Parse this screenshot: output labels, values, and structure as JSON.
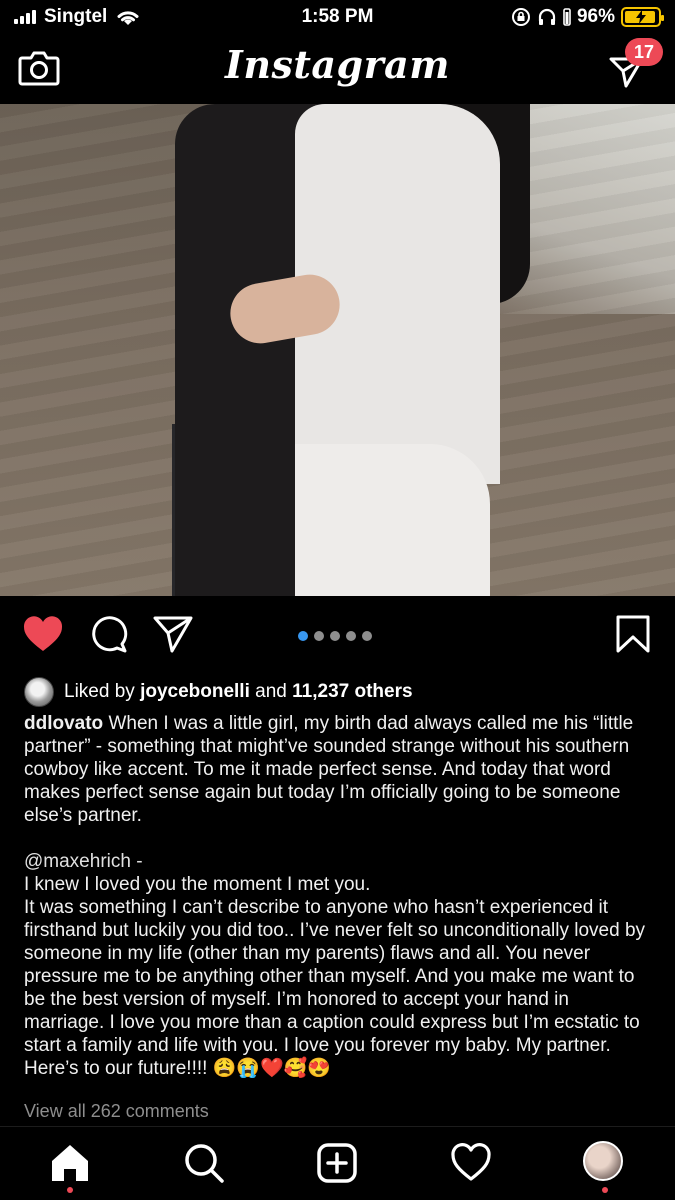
{
  "status_bar": {
    "carrier": "Singtel",
    "time": "1:58 PM",
    "battery": "96%"
  },
  "header": {
    "logo": "Instagram",
    "direct_badge": "17",
    "icons": [
      "camera-icon",
      "direct-message-icon"
    ]
  },
  "post": {
    "photo_icon": "beach-couple-photo",
    "carousel": {
      "count": 5,
      "active_index": 0
    },
    "likes": {
      "prefix": "Liked by",
      "user": "joycebonelli",
      "and": "and",
      "others": "11,237 others"
    },
    "caption": {
      "username": "ddlovato",
      "text": "When I was a little girl, my birth dad always called me his “little partner” - something that might’ve sounded strange without his southern cowboy like accent. To me it made perfect sense. And today that word makes perfect sense again but today I’m officially going to be someone else’s partner.",
      "mention": "@maxehrich -",
      "line1": "I knew I loved you the moment I met you.",
      "body": "It was something I can’t describe to anyone who hasn’t experienced it firsthand but luckily you did too.. I’ve never felt so unconditionally loved by someone in my life (other than my parents) flaws and all. You never pressure me to be anything other than myself. And you make me want to be the best version of myself. I’m honored to accept your hand in marriage. I love you more than a caption could express but I’m ecstatic to start a family and life with you. I love you forever my baby. My partner. Here’s to our future!!!! 😩😭❤️🥰😍"
    },
    "view_comments": "View all 262 comments"
  },
  "colors": {
    "like_red": "#ed4956",
    "badge_red": "#ed4956",
    "carousel_active": "#3897f0",
    "muted": "#8e8e8e",
    "battery_yellow": "#f5c400"
  },
  "bottom_nav": [
    "home-icon",
    "search-icon",
    "add-post-icon",
    "activity-heart-icon",
    "profile-avatar"
  ]
}
